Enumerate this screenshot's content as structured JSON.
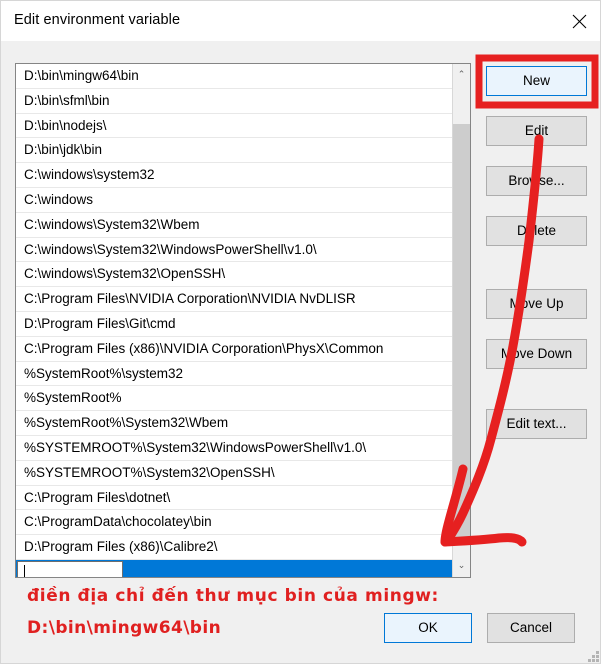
{
  "window": {
    "title": "Edit environment variable",
    "close_icon": "close-icon"
  },
  "list": {
    "items": [
      "D:\\bin\\mingw64\\bin",
      "D:\\bin\\sfml\\bin",
      "D:\\bin\\nodejs\\",
      "D:\\bin\\jdk\\bin",
      "C:\\windows\\system32",
      "C:\\windows",
      "C:\\windows\\System32\\Wbem",
      "C:\\windows\\System32\\WindowsPowerShell\\v1.0\\",
      "C:\\windows\\System32\\OpenSSH\\",
      "C:\\Program Files\\NVIDIA Corporation\\NVIDIA NvDLISR",
      "D:\\Program Files\\Git\\cmd",
      "C:\\Program Files (x86)\\NVIDIA Corporation\\PhysX\\Common",
      "%SystemRoot%\\system32",
      "%SystemRoot%",
      "%SystemRoot%\\System32\\Wbem",
      "%SYSTEMROOT%\\System32\\WindowsPowerShell\\v1.0\\",
      "%SYSTEMROOT%\\System32\\OpenSSH\\",
      "C:\\Program Files\\dotnet\\",
      "C:\\ProgramData\\chocolatey\\bin",
      "D:\\Program Files (x86)\\Calibre2\\"
    ],
    "editing_row_value": "",
    "selected_row_index": 20
  },
  "scrollbar": {
    "up_arrow": "⌃",
    "down_arrow": "⌄"
  },
  "buttons": {
    "new": "New",
    "edit": "Edit",
    "browse": "Browse...",
    "delete": "Delete",
    "move_up": "Move Up",
    "move_down": "Move Down",
    "edit_text": "Edit text...",
    "ok": "OK",
    "cancel": "Cancel"
  },
  "annotations": {
    "line1": "điền địa chỉ đến thư mục bin của mingw:",
    "line2": "D:\\bin\\mingw64\\bin",
    "color": "#e02020",
    "highlight_target": "new"
  },
  "colors": {
    "selection": "#0078d7",
    "annotation_red": "#e02020",
    "button_face": "#e1e1e1",
    "dialog_face": "#f0f0f0"
  }
}
